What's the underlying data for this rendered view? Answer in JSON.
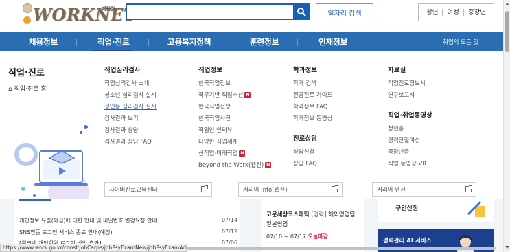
{
  "header": {
    "logo_text": "WORKNET",
    "logo_sub": "재현철",
    "search_placeholder": "",
    "job_search_label": "일자리 검색",
    "segments": [
      "청년",
      "여성",
      "중장년"
    ]
  },
  "nav": {
    "items": [
      "채용정보",
      "직업·진로",
      "고용복지정책",
      "훈련정보",
      "인재정보"
    ],
    "right_label": "취업의 모든 것"
  },
  "mega": {
    "side_title": "직업·진로",
    "side_home": "직업·진로 홈",
    "columns": [
      {
        "title": "직업심리검사",
        "items": [
          "직업심리검사 소개",
          "청소년 심리검사 실시",
          "성인용 심리검사 실시",
          "검사결과 보기",
          "검사결과 상담",
          "검사결과 상담 FAQ"
        ]
      },
      {
        "title": "직업정보",
        "items": [
          "한국직업정보",
          "직무기반 직업추천",
          "한국직업전망",
          "한국직업사전",
          "직업인 인터뷰",
          "다양한 직업세계",
          "신직업·미래직업",
          "Beyond the Work(웹진)"
        ],
        "badge": "N"
      },
      {
        "title": "학과정보",
        "items": [
          "학과 검색",
          "전공진로 가이드",
          "학과정보 FAQ",
          "학과정보 동영상"
        ],
        "sub_title": "진로상담",
        "sub_items": [
          "상담신청",
          "상담 FAQ"
        ]
      },
      {
        "title": "자료실",
        "items": [
          "직업진로정보서",
          "연구보고서"
        ],
        "sub_title": "직업·취업동영상",
        "sub_items": [
          "청년층",
          "경력단절여성",
          "중장년층",
          "직업 동영상·VR"
        ]
      }
    ],
    "ext_links": [
      "사이버진로교육센터",
      "커리어 Info(웹진)",
      "커리어 엔진"
    ]
  },
  "lower": {
    "notices": [
      {
        "text": "개인정보 유출(의심)에 대한 안내 및 비밀번호 변경요청 안내",
        "date": "07/14"
      },
      {
        "text": "SNS연동 로그인 서비스 종료 안내(예정)",
        "date": "07/12"
      },
      {
        "text": "[워크넷 개인회원 로그인 방법 추가]",
        "date": "07/06"
      }
    ],
    "job": {
      "company": "고운세상코스메틱",
      "tag": "[경력]",
      "title": "해외영업팀",
      "title2": "일본영업",
      "date_range": "07/10 ~ 07/17",
      "deadline": "오늘마감"
    },
    "promo_top": "구인신청",
    "promo_ai": "경력관리 AI 서비스"
  },
  "status_url": "https://www.work.go.kr/consltJobCarpa/jobPsyExamNew/jobPsyExamAdultList.do",
  "colors": {
    "brand_blue": "#2a6db3",
    "search_blue": "#1a5fb4",
    "new_badge": "#c8283a",
    "deadline_red": "#d0193a"
  }
}
